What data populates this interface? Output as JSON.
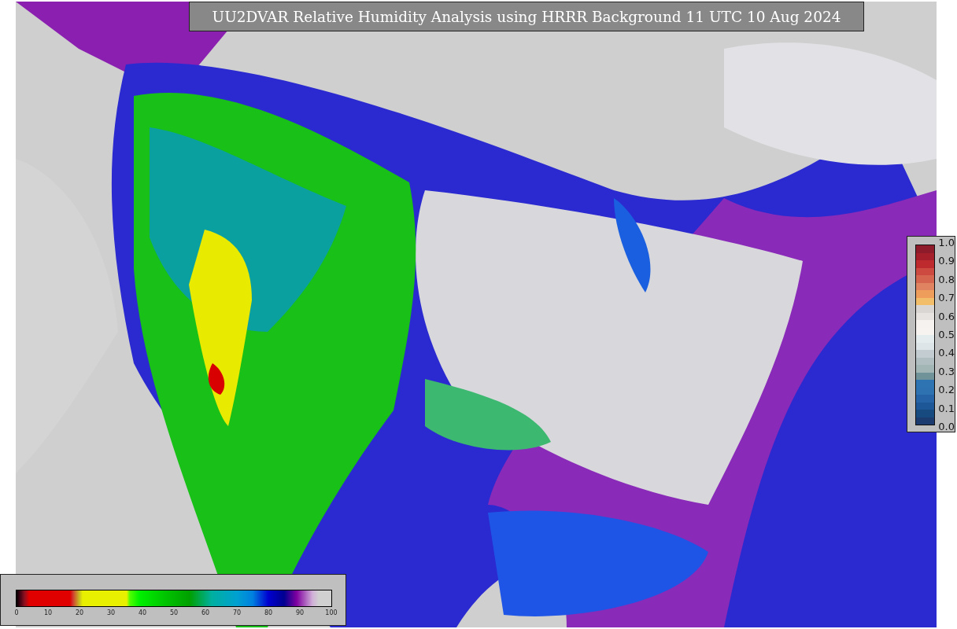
{
  "title": "UU2DVAR Relative Humidity Analysis using HRRR Background 11 UTC 10 Aug 2024",
  "colorbar": {
    "ticks": [
      "0",
      "10",
      "20",
      "30",
      "40",
      "50",
      "60",
      "70",
      "80",
      "90",
      "100"
    ]
  },
  "legend": {
    "ticks": [
      "1.0",
      "0.9",
      "0.8",
      "0.7",
      "0.6",
      "0.5",
      "0.4",
      "0.3",
      "0.2",
      "0.1",
      "0.0"
    ]
  }
}
